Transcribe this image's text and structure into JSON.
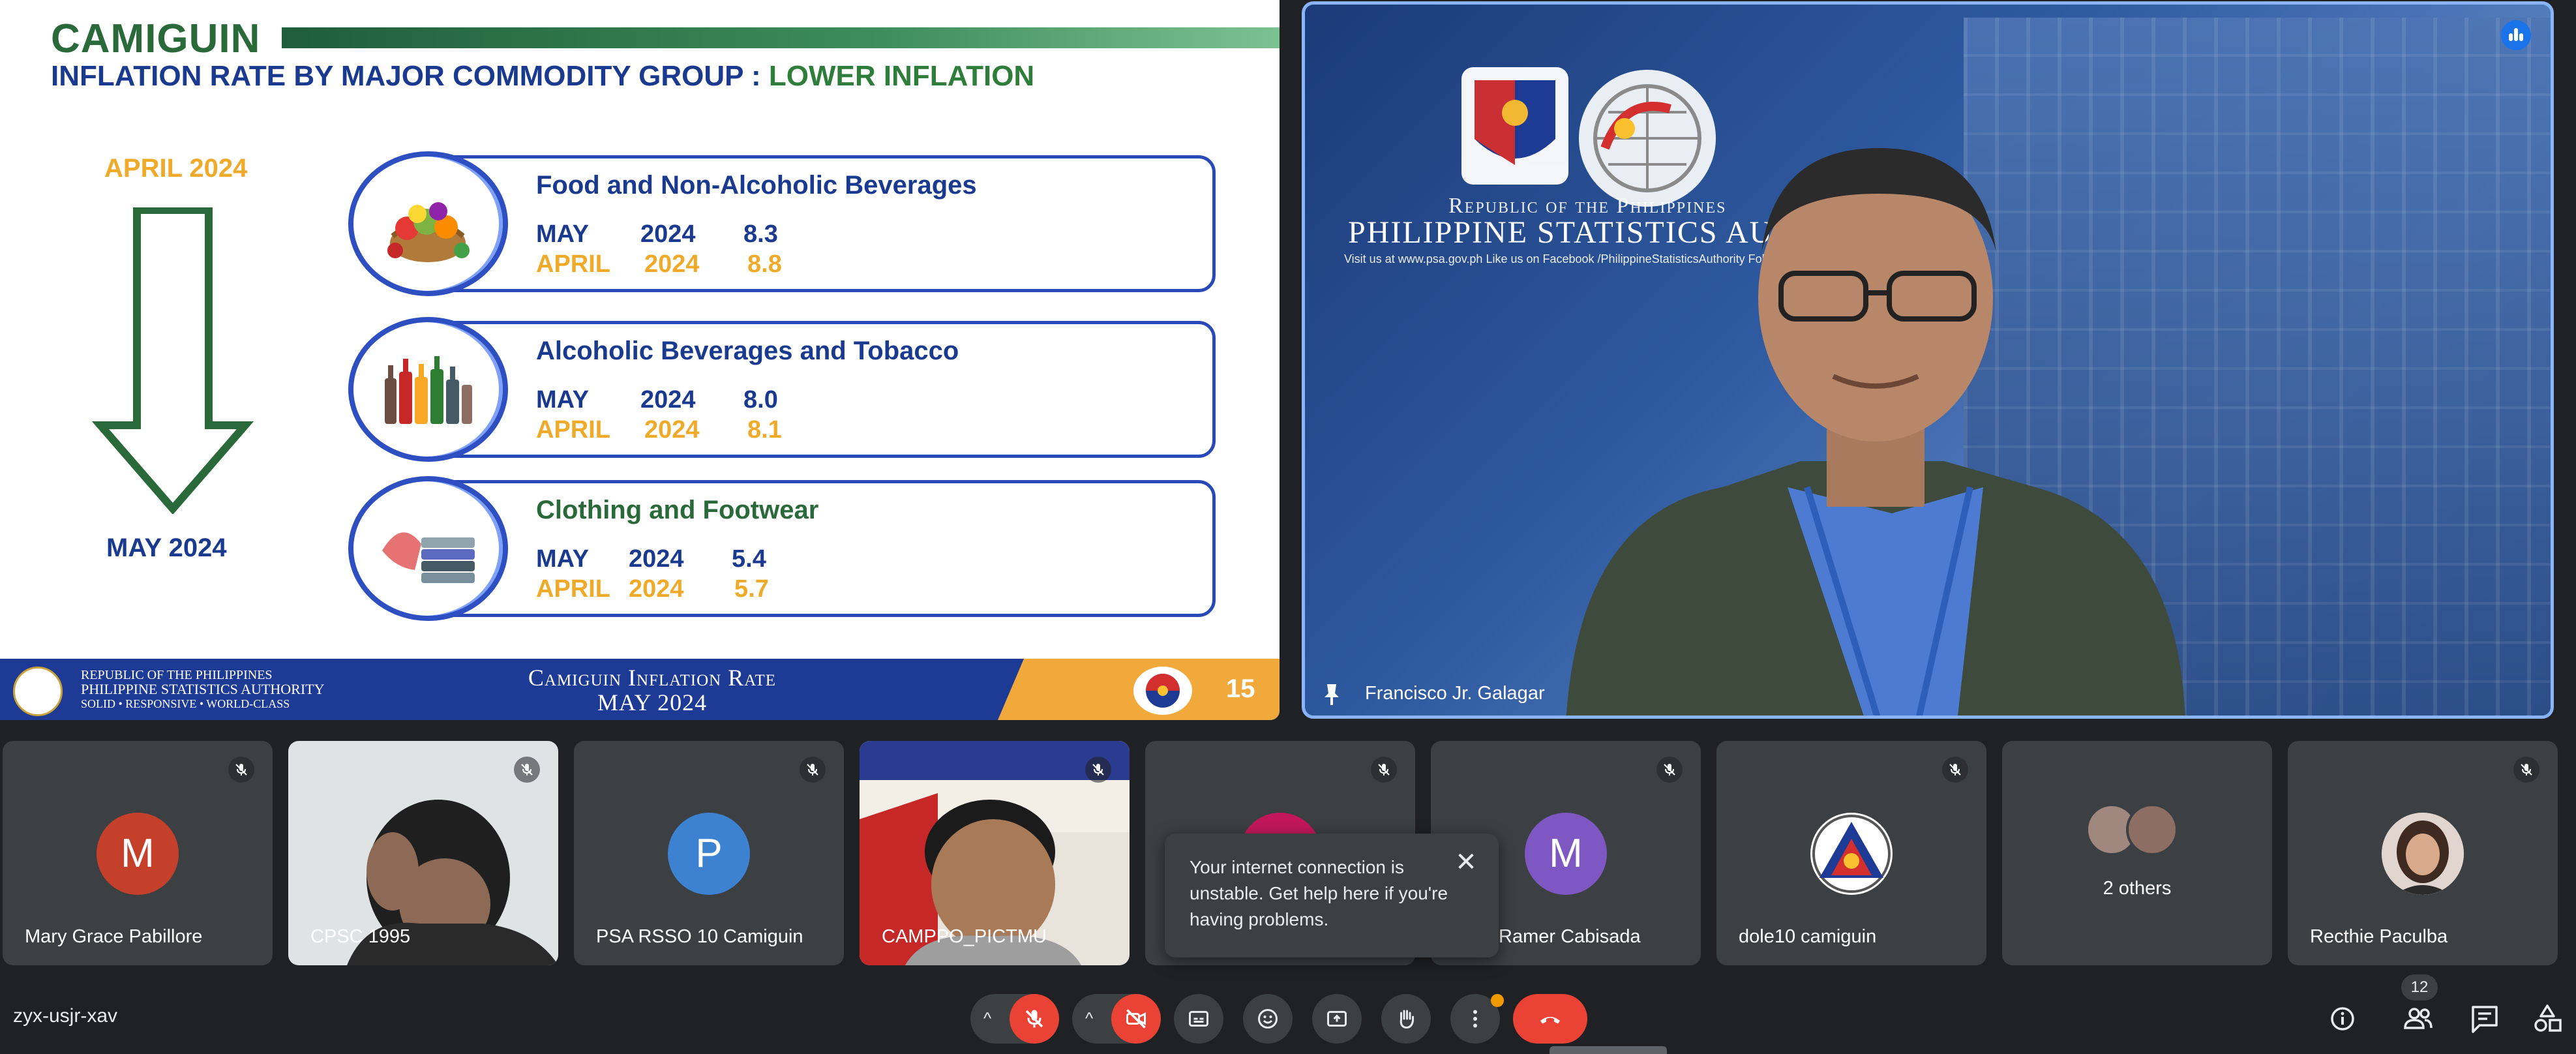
{
  "slide": {
    "title": "CAMIGUIN",
    "subtitle_main": "INFLATION RATE BY MAJOR COMMODITY GROUP : ",
    "subtitle_accent": "LOWER INFLATION",
    "from_label": "APRIL 2024",
    "to_label": "MAY 2024",
    "categories": [
      {
        "name": "Food and Non-Alcoholic Beverages",
        "icon": "food-basket-icon",
        "row1": {
          "month": "MAY",
          "year": "2024",
          "value": "8.3"
        },
        "row2": {
          "month": "APRIL",
          "year": "2024",
          "value": "8.8"
        }
      },
      {
        "name": "Alcoholic Beverages and Tobacco",
        "icon": "bottles-icon",
        "row1": {
          "month": "MAY",
          "year": "2024",
          "value": "8.0"
        },
        "row2": {
          "month": "APRIL",
          "year": "2024",
          "value": "8.1"
        }
      },
      {
        "name": "Clothing and Footwear",
        "icon": "clothes-icon",
        "row1": {
          "month": "MAY",
          "year": "2024",
          "value": "5.4"
        },
        "row2": {
          "month": "APRIL",
          "year": "2024",
          "value": "5.7"
        }
      }
    ],
    "footer": {
      "org_line1": "Republic of the Philippines",
      "org_line2": "Philippine Statistics Authority",
      "org_line3": "Solid • Responsive • World-Class",
      "title_line1": "Camiguin Inflation Rate",
      "title_line2": "MAY 2024",
      "page": "15"
    },
    "colors": {
      "green": "#2a6a3a",
      "blue": "#1a3a8f",
      "orange": "#f0aa2a"
    }
  },
  "speaker": {
    "bg_line1": "Republic of the Philippines",
    "bg_line2": "PHILIPPINE STATISTICS AUTHO",
    "bg_links": "Visit us at www.psa.gov.ph        Like us on Facebook /PhilippineStatisticsAuthority        Follow @PSAgov",
    "name": "Francisco Jr. Galagar"
  },
  "participants": [
    {
      "name": "Mary Grace Pabillore",
      "initial": "M",
      "color": "#c5402b"
    },
    {
      "name": "CPSC 1995",
      "initial": "",
      "color": ""
    },
    {
      "name": "PSA RSSO 10 Camiguin",
      "initial": "P",
      "color": "#3c82d0"
    },
    {
      "name": "CAMPPO_PICTMU",
      "initial": "",
      "color": ""
    },
    {
      "name": "",
      "initial": "",
      "color": "#c2185b"
    },
    {
      "name": "Ramer Cabisada",
      "initial": "M",
      "color": "#7e57c2"
    },
    {
      "name": "dole10 camiguin",
      "initial": "",
      "color": ""
    },
    {
      "name": "2 others",
      "initial": "",
      "color": ""
    },
    {
      "name": "Recthie Paculba",
      "initial": "",
      "color": ""
    }
  ],
  "toast": {
    "message": "Your internet connection is unstable. Get help here if you're having problems."
  },
  "controls": {
    "meeting_code": "zyx-usjr-xav",
    "participant_count": "12"
  }
}
